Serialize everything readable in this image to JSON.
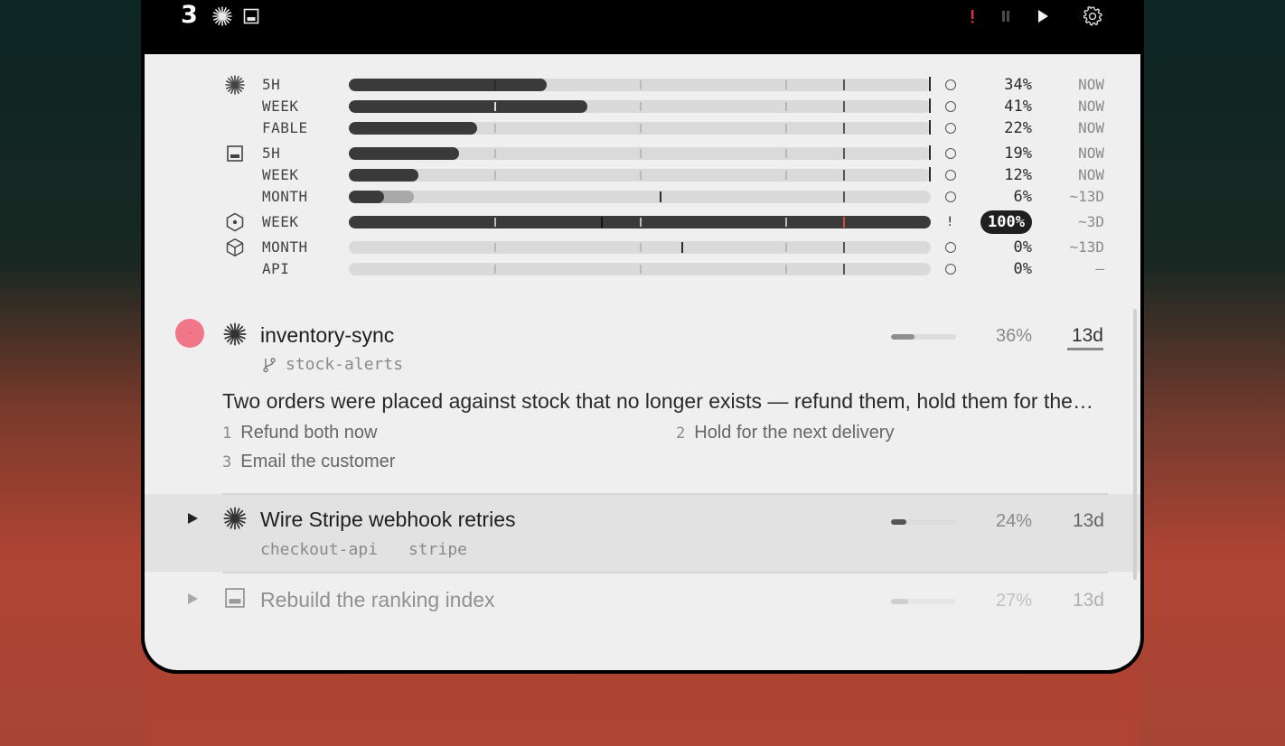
{
  "topbar": {
    "count": "3",
    "icons": [
      "claude-burst-icon",
      "window-icon"
    ],
    "right_icons": [
      "alert-icon",
      "pause-icon",
      "play-icon",
      "gear-icon"
    ],
    "alert_color": "#e0313a"
  },
  "meters": [
    {
      "icon": "claude-burst-icon",
      "label": "5H",
      "pct": "34%",
      "when": "NOW",
      "fill": 0.34
    },
    {
      "icon": "",
      "label": "WEEK",
      "pct": "41%",
      "when": "NOW",
      "fill": 0.41
    },
    {
      "icon": "",
      "label": "FABLE",
      "pct": "22%",
      "when": "NOW",
      "fill": 0.22
    },
    {
      "icon": "window-icon",
      "label": "5H",
      "pct": "19%",
      "when": "NOW",
      "fill": 0.19
    },
    {
      "icon": "",
      "label": "WEEK",
      "pct": "12%",
      "when": "NOW",
      "fill": 0.12
    },
    {
      "icon": "",
      "label": "MONTH",
      "pct": "6%",
      "when": "~13D",
      "fill": 0.06
    },
    {
      "icon": "hexagon-icon",
      "label": "WEEK",
      "pct": "100%",
      "when": "~3D",
      "fill": 1.0
    },
    {
      "icon": "cube-icon",
      "label": "MONTH",
      "pct": "0%",
      "when": "~13D",
      "fill": 0.0
    },
    {
      "icon": "",
      "label": "API",
      "pct": "0%",
      "when": "—",
      "fill": 0.0
    }
  ],
  "tasks": [
    {
      "title": "inventory-sync",
      "branch": "stock-alerts",
      "pct": "36%",
      "age": "13d",
      "progress": 0.36,
      "description": "Two orders were placed against stock that no longer exists — refund them, hold them for the next delivery, or email the customer?",
      "options": [
        {
          "n": "1",
          "label": "Refund both now"
        },
        {
          "n": "2",
          "label": "Hold for the next delivery"
        },
        {
          "n": "3",
          "label": "Email the customer"
        }
      ]
    },
    {
      "title": "Wire Stripe webhook retries",
      "tags": [
        "checkout-api",
        "stripe"
      ],
      "pct": "24%",
      "age": "13d",
      "progress": 0.24
    },
    {
      "title": "Rebuild the ranking index",
      "pct": "27%",
      "age": "13d",
      "progress": 0.27
    }
  ],
  "colors": {
    "accent_red": "#f17688",
    "pill_bg": "#1f1f1f"
  }
}
